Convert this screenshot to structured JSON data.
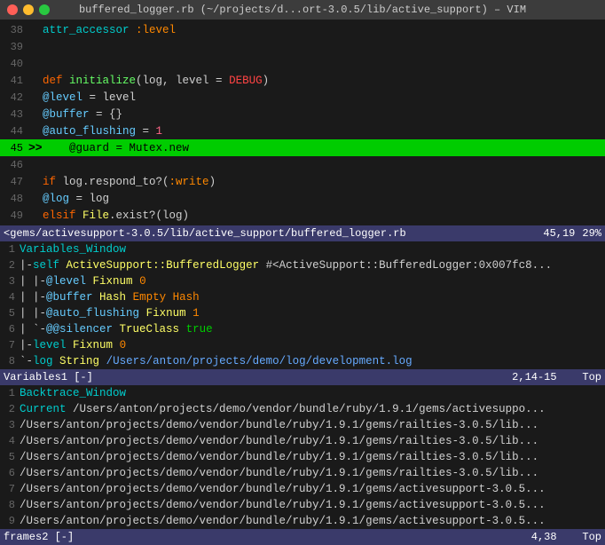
{
  "titlebar": {
    "title": "buffered_logger.rb (~/projects/d...ort-3.0.5/lib/active_support) – VIM"
  },
  "editor": {
    "lines": [
      {
        "num": "38",
        "content": "  attr_accessor :level",
        "tokens": [
          {
            "t": "kw2",
            "v": "attr_accessor"
          },
          {
            "t": "norm",
            "v": " "
          },
          {
            "t": "sym",
            "v": ":level"
          }
        ]
      },
      {
        "num": "39",
        "content": "",
        "tokens": []
      },
      {
        "num": "40",
        "content": "",
        "tokens": []
      },
      {
        "num": "41",
        "content": "  def initialize(log, level = DEBUG)",
        "tokens": [
          {
            "t": "kw",
            "v": "def"
          },
          {
            "t": "norm",
            "v": " "
          },
          {
            "t": "method",
            "v": "initialize"
          },
          {
            "t": "norm",
            "v": "(log, level = "
          },
          {
            "t": "const",
            "v": "DEBUG"
          },
          {
            "t": "norm",
            "v": ")"
          }
        ]
      },
      {
        "num": "42",
        "content": "    @level         = level",
        "tokens": [
          {
            "t": "var",
            "v": "@level"
          },
          {
            "t": "norm",
            "v": "         = level"
          }
        ]
      },
      {
        "num": "43",
        "content": "    @buffer        = {}",
        "tokens": [
          {
            "t": "var",
            "v": "@buffer"
          },
          {
            "t": "norm",
            "v": "        = {}"
          }
        ]
      },
      {
        "num": "44",
        "content": "    @auto_flushing = 1",
        "tokens": [
          {
            "t": "var",
            "v": "@auto_flushing"
          },
          {
            "t": "norm",
            "v": " = "
          },
          {
            "t": "num",
            "v": "1"
          }
        ]
      },
      {
        "num": "45",
        "content": "    @guard = Mutex.new",
        "current": true,
        "tokens": [
          {
            "t": "norm",
            "v": "    @guard = Mutex.new"
          }
        ]
      },
      {
        "num": "46",
        "content": "",
        "tokens": []
      },
      {
        "num": "47",
        "content": "    if log.respond_to?(:write)",
        "tokens": [
          {
            "t": "kw",
            "v": "if"
          },
          {
            "t": "norm",
            "v": " log.respond_to?("
          },
          {
            "t": "sym",
            "v": ":write"
          },
          {
            "t": "norm",
            "v": ")"
          }
        ]
      },
      {
        "num": "48",
        "content": "      @log = log",
        "tokens": [
          {
            "t": "var",
            "v": "@log"
          },
          {
            "t": "norm",
            "v": " = log"
          }
        ]
      },
      {
        "num": "49",
        "content": "    elsif File.exist?(log)",
        "tokens": [
          {
            "t": "kw",
            "v": "elsif"
          },
          {
            "t": "norm",
            "v": " "
          },
          {
            "t": "const",
            "v": "File"
          },
          {
            "t": "norm",
            "v": ".exist?(log)"
          }
        ]
      }
    ],
    "status": {
      "path": "<gems/activesupport-3.0.5/lib/active_support/buffered_logger.rb",
      "pos": "45,19",
      "pct": "29%"
    }
  },
  "variables_window": {
    "header": "Variables_Window",
    "lines": [
      {
        "num": "1",
        "content": "Variables_Window",
        "header": true
      },
      {
        "num": "2",
        "text": "|-self  ActiveSupport::BufferedLogger #<ActiveSupport::BufferedLogger:0x007fc8..."
      },
      {
        "num": "3",
        "text": "| |-@level  Fixnum  0"
      },
      {
        "num": "4",
        "text": "| |-@buffer  Hash  Empty Hash"
      },
      {
        "num": "5",
        "text": "| |-@auto_flushing  Fixnum  1"
      },
      {
        "num": "6",
        "text": "| `-@@silencer  TrueClass  true"
      },
      {
        "num": "7",
        "text": "|-level  Fixnum  0"
      },
      {
        "num": "8",
        "text": "`-log  String  /Users/anton/projects/demo/log/development.log"
      }
    ],
    "bottom_bar": {
      "name": "Variables1",
      "pos": "2,14-15",
      "pct": "Top"
    }
  },
  "backtrace_window": {
    "header": "Backtrace_Window",
    "lines": [
      {
        "num": "1",
        "text": "Backtrace_Window",
        "header": true
      },
      {
        "num": "2",
        "text": "Current /Users/anton/projects/demo/vendor/bundle/ruby/1.9.1/gems/activesuppo..."
      },
      {
        "num": "3",
        "text": "/Users/anton/projects/demo/vendor/bundle/ruby/1.9.1/gems/railties-3.0.5/lib..."
      },
      {
        "num": "4",
        "text": "/Users/anton/projects/demo/vendor/bundle/ruby/1.9.1/gems/railties-3.0.5/lib..."
      },
      {
        "num": "5",
        "text": "/Users/anton/projects/demo/vendor/bundle/ruby/1.9.1/gems/railties-3.0.5/lib..."
      },
      {
        "num": "6",
        "text": "/Users/anton/projects/demo/vendor/bundle/ruby/1.9.1/gems/railties-3.0.5/lib..."
      },
      {
        "num": "7",
        "text": "/Users/anton/projects/demo/vendor/bundle/ruby/1.9.1/gems/activesupport-3.0.5..."
      },
      {
        "num": "8",
        "text": "/Users/anton/projects/demo/vendor/bundle/ruby/1.9.1/gems/activesupport-3.0.5..."
      },
      {
        "num": "9",
        "text": "/Users/anton/projects/demo/vendor/bundle/ruby/1.9.1/gems/activesupport-3.0.5..."
      }
    ],
    "bottom_bar": {
      "name": "frames2",
      "pos": "4,38",
      "pct": "Top"
    }
  }
}
